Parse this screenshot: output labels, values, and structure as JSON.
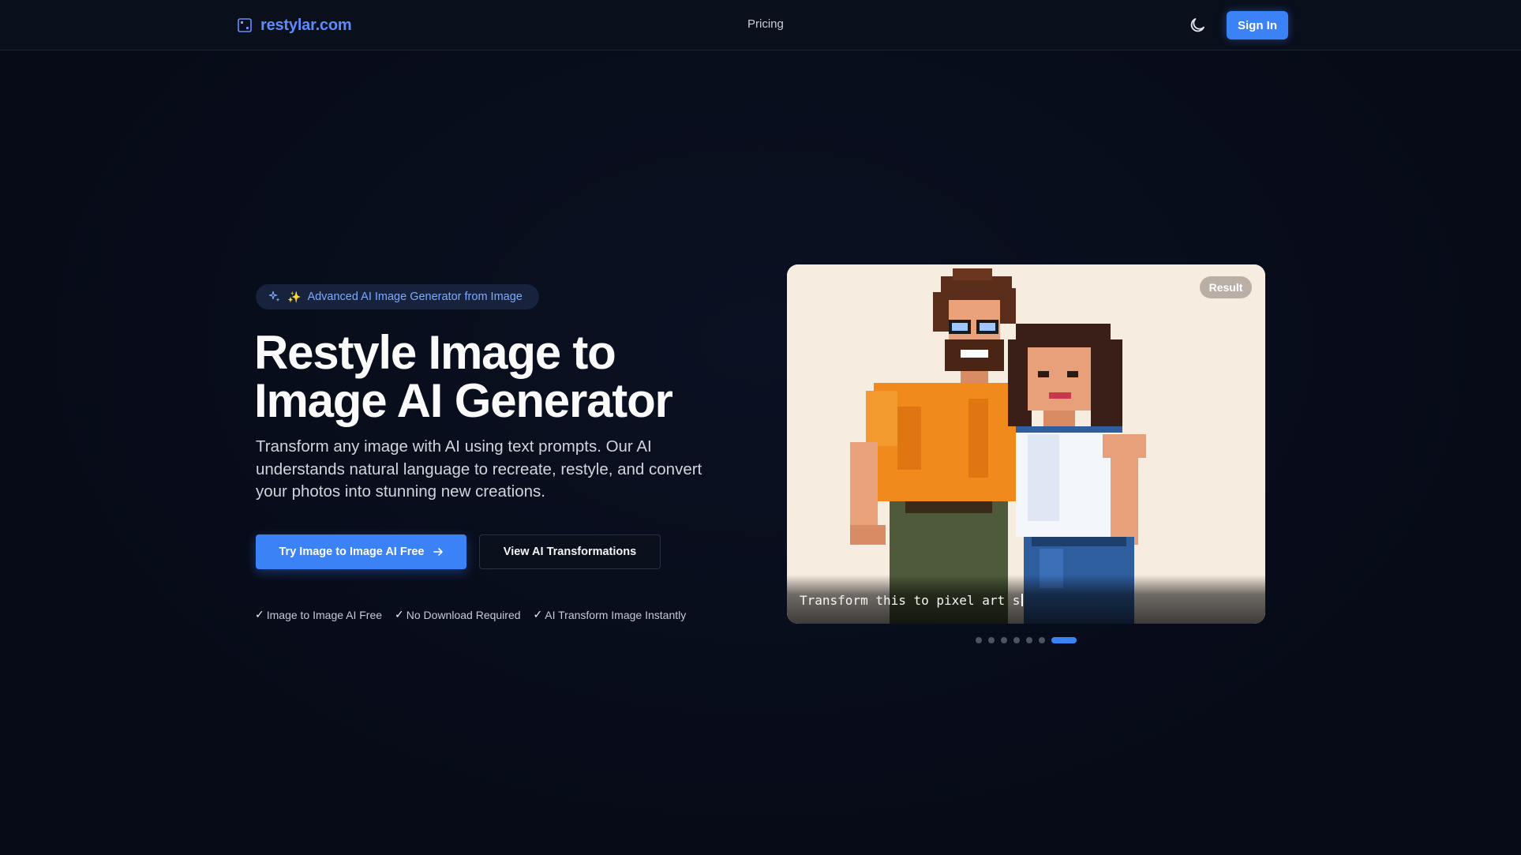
{
  "header": {
    "logo_text": "restylar.com",
    "nav": {
      "pricing": "Pricing"
    },
    "sign_in": "Sign In",
    "theme_icon": "moon-icon"
  },
  "hero": {
    "badge": "Advanced AI Image Generator from Image",
    "title": "Restyle Image to Image AI Generator",
    "subtitle": "Transform any image with AI using text prompts. Our AI understands natural language to recreate, restyle, and convert your photos into stunning new creations.",
    "primary_cta": "Try Image to Image AI Free",
    "secondary_cta": "View AI Transformations",
    "features": [
      "Image to Image AI Free",
      "No Download Required",
      "AI Transform Image Instantly"
    ]
  },
  "showcase": {
    "result_label": "Result",
    "prompt": "Transform this to pixel art s",
    "slide_count": 7,
    "active_slide": 7
  },
  "colors": {
    "accent": "#3b82f6",
    "background": "#070b18",
    "header_bg": "#0a0f1c"
  }
}
